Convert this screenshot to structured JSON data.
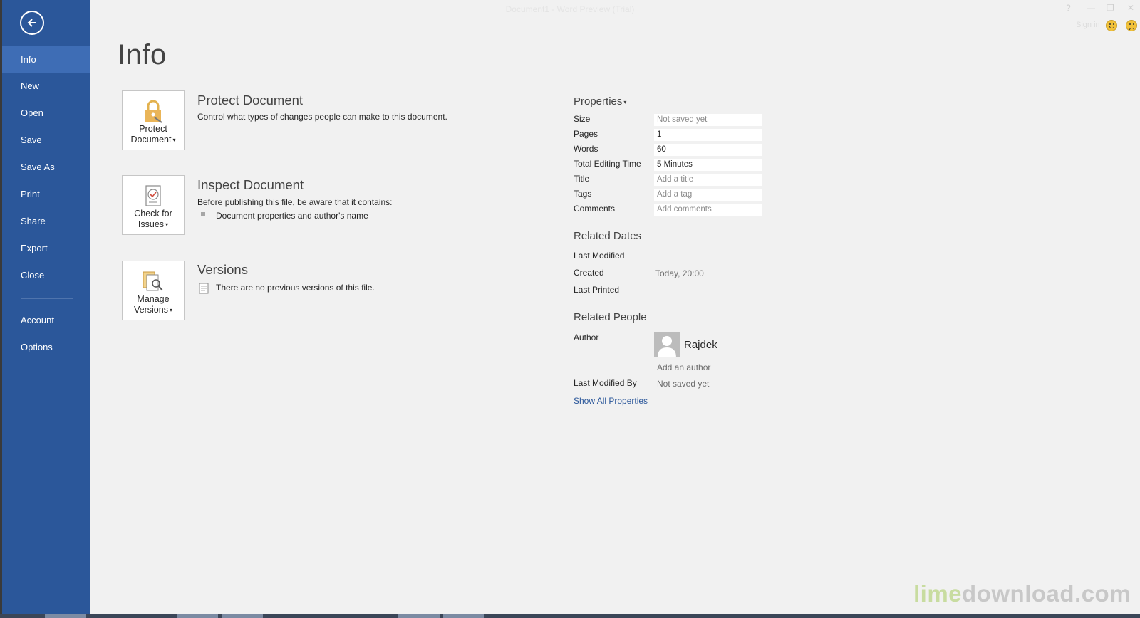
{
  "window": {
    "title": "Document1 - Word Preview (Trial)",
    "controls": [
      "?",
      "—",
      "❐",
      "✕"
    ],
    "sign_in": "Sign in"
  },
  "sidebar": {
    "back_icon": "back-arrow-icon",
    "items": [
      {
        "label": "Info",
        "selected": true
      },
      {
        "label": "New"
      },
      {
        "label": "Open"
      },
      {
        "label": "Save"
      },
      {
        "label": "Save As"
      },
      {
        "label": "Print"
      },
      {
        "label": "Share"
      },
      {
        "label": "Export"
      },
      {
        "label": "Close"
      },
      {
        "label": "Account"
      },
      {
        "label": "Options"
      }
    ],
    "colors": {
      "background": "#2b579a",
      "selected": "#3e6db5"
    }
  },
  "page": {
    "title": "Info"
  },
  "sections": {
    "protect": {
      "button_line1": "Protect",
      "button_line2": "Document",
      "title": "Protect Document",
      "desc": "Control what types of changes people can make to this document."
    },
    "inspect": {
      "button_line1": "Check for",
      "button_line2": "Issues",
      "title": "Inspect Document",
      "desc": "Before publishing this file, be aware that it contains:",
      "bullet": "Document properties and author's name"
    },
    "versions": {
      "button_line1": "Manage",
      "button_line2": "Versions",
      "title": "Versions",
      "desc": "There are no previous versions of this file."
    }
  },
  "properties": {
    "heading": "Properties",
    "rows": [
      {
        "label": "Size",
        "value": "Not saved yet"
      },
      {
        "label": "Pages",
        "value": "1"
      },
      {
        "label": "Words",
        "value": "60"
      },
      {
        "label": "Total Editing Time",
        "value": "5 Minutes"
      },
      {
        "label": "Title",
        "value": "Add a title"
      },
      {
        "label": "Tags",
        "value": "Add a tag"
      },
      {
        "label": "Comments",
        "value": "Add comments"
      }
    ]
  },
  "related_dates": {
    "heading": "Related Dates",
    "last_modified_label": "Last Modified",
    "created_label": "Created",
    "created_value": "Today, 20:00",
    "last_printed_label": "Last Printed"
  },
  "related_people": {
    "heading": "Related People",
    "author_label": "Author",
    "author_name": "Rajdek",
    "add_author": "Add an author",
    "last_modified_by_label": "Last Modified By",
    "last_modified_by_value": "Not saved yet"
  },
  "show_all_link": "Show All Properties",
  "watermark": {
    "part1": "lime",
    "part2": "download.com"
  }
}
